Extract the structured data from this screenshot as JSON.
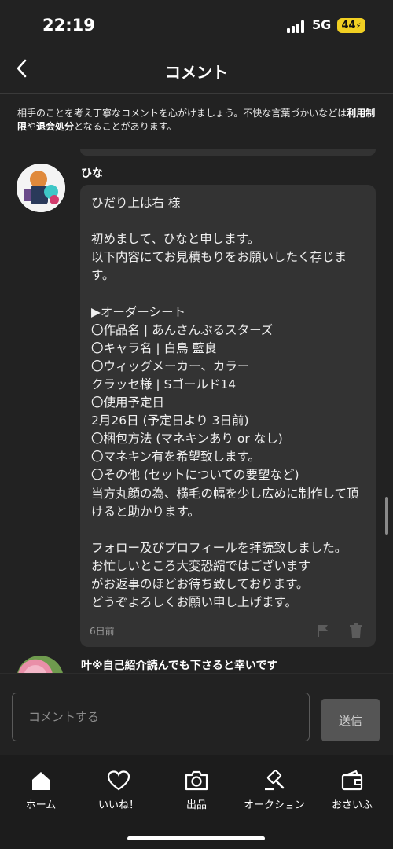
{
  "status_bar": {
    "time": "22:19",
    "network": "5G",
    "battery": "44"
  },
  "header": {
    "title": "コメント"
  },
  "notice": {
    "part1": "相手のことを考え丁寧なコメントを心がけましょう。不快な言葉づかいなどは",
    "bold1": "利用制限",
    "part2": "や",
    "bold2": "退会処分",
    "part3": "となることがあります。"
  },
  "comment": {
    "author": "ひな",
    "body": "ひだり上は右 様\n\n初めまして、ひなと申します。\n以下内容にてお見積もりをお願いしたく存じます。\n\n▶オーダーシート\n〇作品名 | あんさんぶるスターズ\n〇キャラ名 | 白鳥 藍良\n〇ウィッグメーカー、カラー\nクラッセ様 | Sゴールド14\n〇使用予定日\n2月26日 (予定日より 3日前)\n〇梱包方法 (マネキンあり or なし)\n〇マネキン有を希望致します。\n〇その他 (セットについての要望など)\n当方丸顔の為、横毛の幅を少し広めに制作して頂けると助かります。\n\nフォロー及びプロフィールを拝読致しました。\nお忙しいところ大変恐縮ではございます\nがお返事のほどお待ち致しております。\nどうぞよろしくお願い申し上げます。",
    "time": "6日前",
    "flag_icon": "flag-icon",
    "trash_icon": "trash-icon"
  },
  "next_comment": {
    "text": "叶※自己紹介読んでも下さると幸いです"
  },
  "input": {
    "placeholder": "コメントする",
    "send_label": "送信"
  },
  "tabs": [
    {
      "label": "ホーム",
      "icon": "home-icon"
    },
    {
      "label": "いいね！",
      "icon": "heart-icon"
    },
    {
      "label": "出品",
      "icon": "camera-icon"
    },
    {
      "label": "オークション",
      "icon": "gavel-icon"
    },
    {
      "label": "おさいふ",
      "icon": "wallet-icon"
    }
  ],
  "colors": {
    "background": "#222222",
    "bubble": "#333333",
    "send_button": "#555555"
  }
}
